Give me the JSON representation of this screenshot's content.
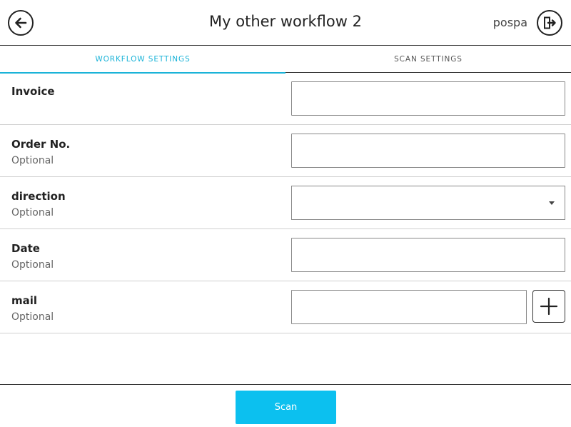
{
  "header": {
    "title": "My other workflow 2",
    "username": "pospa",
    "back_icon": "arrow-left-icon",
    "logout_icon": "logout-icon"
  },
  "tabs": [
    {
      "label": "WORKFLOW SETTINGS",
      "active": true
    },
    {
      "label": "SCAN SETTINGS",
      "active": false
    }
  ],
  "fields": [
    {
      "label": "Invoice",
      "sublabel": "",
      "type": "text",
      "value": ""
    },
    {
      "label": "Order No.",
      "sublabel": "Optional",
      "type": "text",
      "value": ""
    },
    {
      "label": "direction",
      "sublabel": "Optional",
      "type": "select",
      "value": ""
    },
    {
      "label": "Date",
      "sublabel": "Optional",
      "type": "text",
      "value": ""
    },
    {
      "label": "mail",
      "sublabel": "Optional",
      "type": "text-with-add",
      "value": ""
    }
  ],
  "footer": {
    "scan_label": "Scan"
  },
  "colors": {
    "accent": "#1ab3d8",
    "scan_button": "#0cc0ef",
    "border": "#333333"
  }
}
